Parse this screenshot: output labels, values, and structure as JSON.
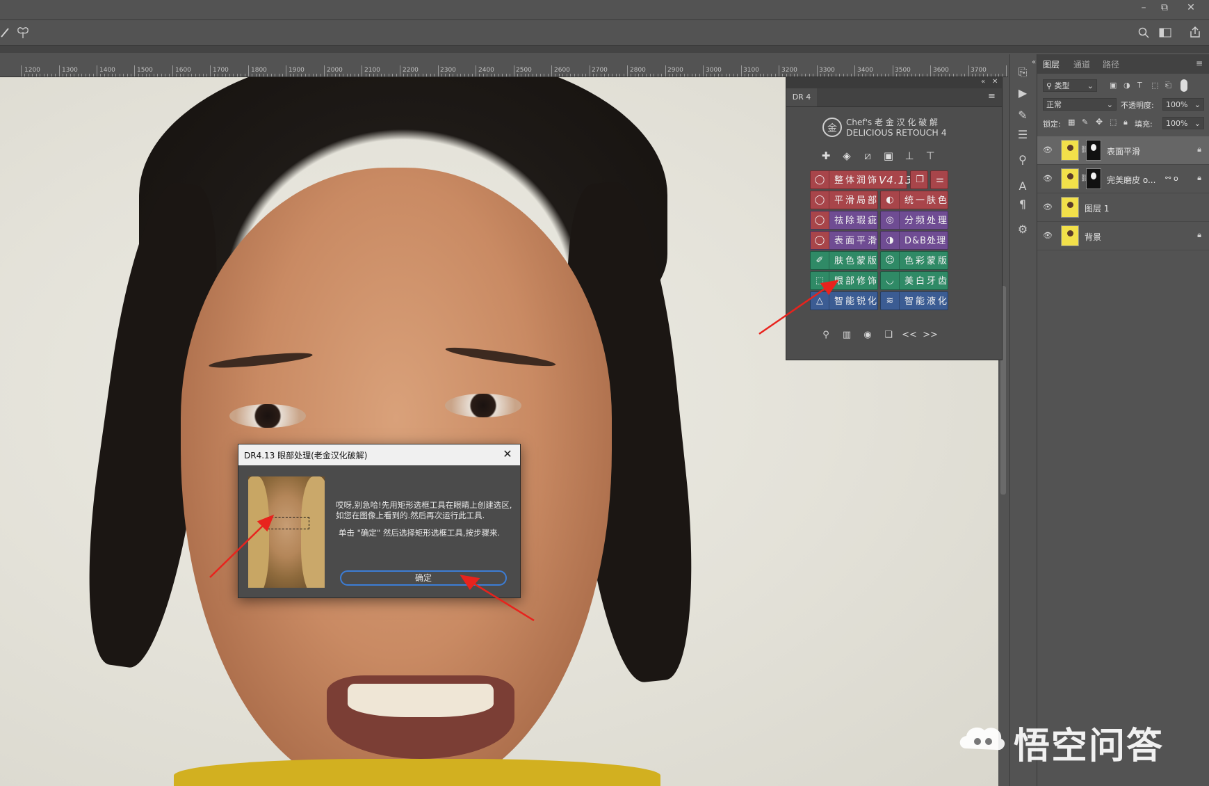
{
  "window_controls": {
    "minimize": "–",
    "restore": "⧉",
    "close": "✕"
  },
  "options_bar": {
    "pen_icon": "pen-icon",
    "butterfly_icon": "butterfly-icon"
  },
  "ruler": {
    "labels": [
      "1200",
      "1300",
      "1400",
      "1500",
      "1600",
      "1700",
      "1800",
      "1900",
      "2000",
      "2100",
      "2200",
      "2300",
      "2400",
      "2500",
      "2600",
      "2700",
      "2800",
      "2900",
      "3000",
      "3100",
      "3200",
      "3300",
      "3400",
      "3500",
      "3600",
      "3700"
    ]
  },
  "dr4": {
    "tab": "DR 4",
    "brand_line1": "Chef's 老 金 汉 化 破 解",
    "brand_line2": "DELICIOUS RETOUCH 4",
    "logo_char": "金",
    "buttons": {
      "overall": "整体润饰",
      "version": "V4.13",
      "smooth_local": "平滑局部",
      "unify_skin": "统一肤色",
      "remove_blemish": "祛除瑕疵",
      "freq_sep": "分频处理",
      "surface_smooth": "表面平滑",
      "dodge_burn": "D&B处理",
      "skin_mask": "肤色蒙版",
      "color_mask": "色彩蒙版",
      "eye_retouch": "眼部修饰",
      "teeth_whiten": "美白牙齿",
      "smart_sharpen": "智能锐化",
      "smart_liquify": "智能液化"
    },
    "footer": {
      "prev": "<<",
      "next": ">>"
    }
  },
  "layers_panel": {
    "tabs": [
      "图层",
      "通道",
      "路径"
    ],
    "filter_label": "类型",
    "blend_mode": "正常",
    "opacity_label": "不透明度:",
    "opacity_value": "100%",
    "lock_label": "锁定:",
    "fill_label": "填充:",
    "fill_value": "100%",
    "layers": [
      {
        "name": "表面平滑"
      },
      {
        "name": "完美磨皮 o...",
        "suffix": "o"
      },
      {
        "name": "图层 1"
      },
      {
        "name": "背景"
      }
    ]
  },
  "dialog": {
    "title": "DR4.13 眼部处理(老金汉化破解)",
    "message1": "哎呀,别急哈!先用矩形选框工具在眼睛上创建选区,如您在图像上看到的.然后再次运行此工具.",
    "message2": "单击 \"确定\" 然后选择矩形选框工具,按步骤来.",
    "ok_label": "确定"
  },
  "watermark": {
    "text": "悟空问答"
  },
  "colors": {
    "accent_red": "#a8454a",
    "accent_purple": "#6f4c93",
    "accent_green": "#2f8a66",
    "accent_blue": "#3b5c93",
    "ok_border": "#3c7dd6",
    "arrow": "#e8231d"
  }
}
